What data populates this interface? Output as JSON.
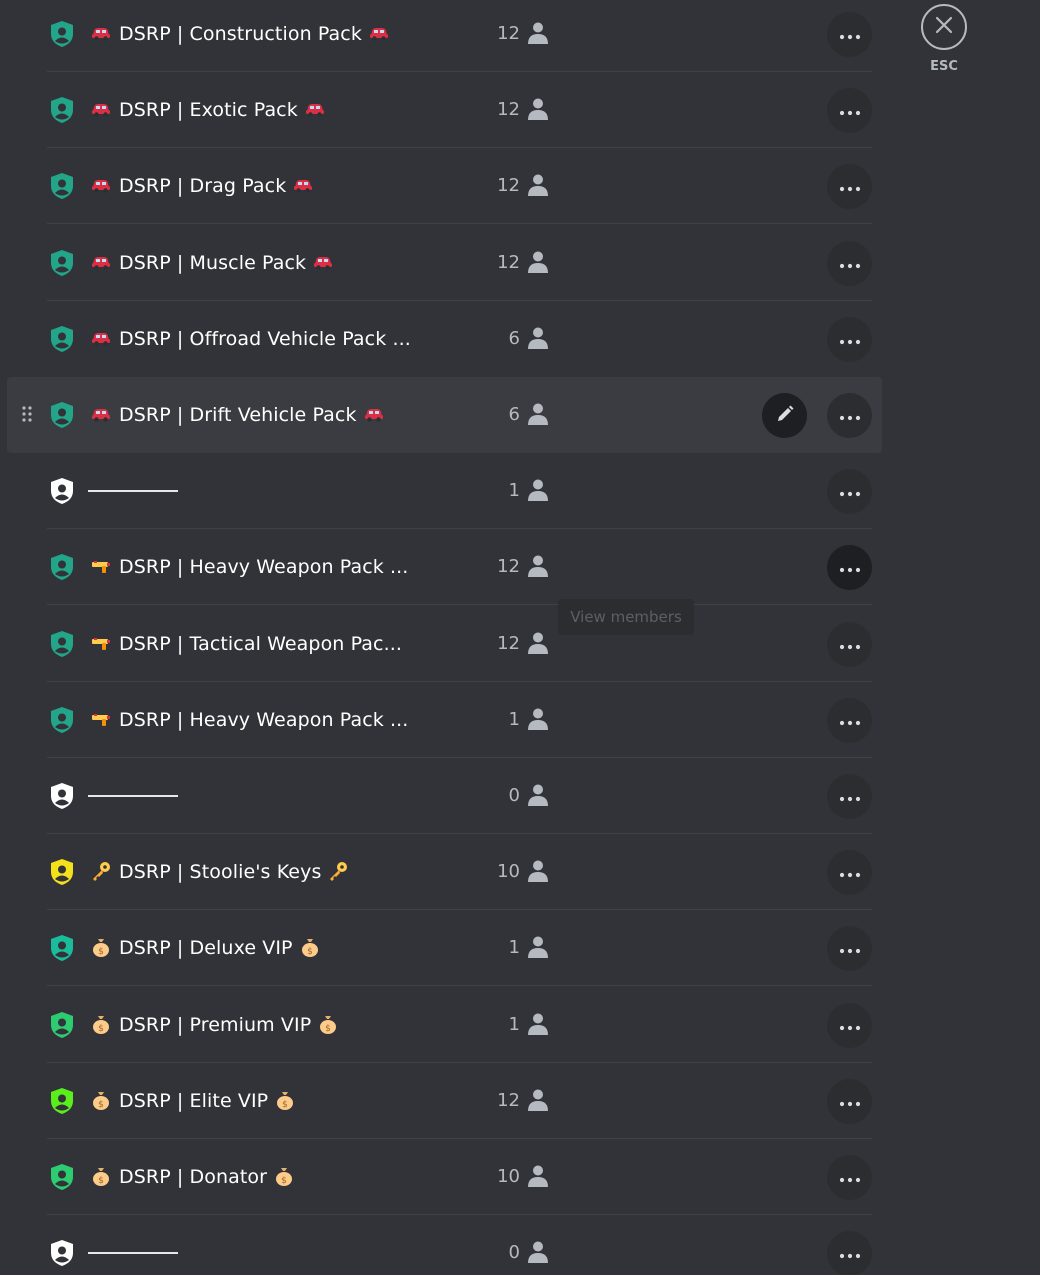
{
  "close": {
    "label": "ESC"
  },
  "tooltip": {
    "text": "View members"
  },
  "roles": [
    {
      "name": "DSRP | Construction Pack",
      "emoji": "car",
      "trail": "car",
      "count": "12",
      "shield_color": "#23a589",
      "divider": false
    },
    {
      "name": "DSRP | Exotic Pack",
      "emoji": "car",
      "trail": "car",
      "count": "12",
      "shield_color": "#23a589",
      "divider": false
    },
    {
      "name": "DSRP | Drag Pack",
      "emoji": "car",
      "trail": "car",
      "count": "12",
      "shield_color": "#23a589",
      "divider": false
    },
    {
      "name": "DSRP | Muscle Pack",
      "emoji": "car",
      "trail": "car",
      "count": "12",
      "shield_color": "#23a589",
      "divider": false
    },
    {
      "name": "DSRP | Offroad Vehicle Pack ...",
      "emoji": "car",
      "trail": "",
      "count": "6",
      "shield_color": "#23a589",
      "divider": false
    },
    {
      "name": "DSRP | Drift Vehicle Pack",
      "emoji": "car",
      "trail": "car",
      "count": "6",
      "shield_color": "#23a589",
      "divider": false,
      "active": true
    },
    {
      "name": "",
      "emoji": "",
      "trail": "",
      "count": "1",
      "shield_color": "#ffffff",
      "divider": true
    },
    {
      "name": "DSRP | Heavy Weapon Pack ...",
      "emoji": "gun",
      "trail": "",
      "count": "12",
      "shield_color": "#23a589",
      "divider": false,
      "hover_more": true
    },
    {
      "name": "DSRP | Tactical Weapon Pac...",
      "emoji": "gun",
      "trail": "",
      "count": "12",
      "shield_color": "#23a589",
      "divider": false
    },
    {
      "name": "DSRP | Heavy Weapon Pack ...",
      "emoji": "gun",
      "trail": "",
      "count": "1",
      "shield_color": "#23a589",
      "divider": false
    },
    {
      "name": "",
      "emoji": "",
      "trail": "",
      "count": "0",
      "shield_color": "#ffffff",
      "divider": true
    },
    {
      "name": "DSRP | Stoolie's Keys",
      "emoji": "key",
      "trail": "key",
      "count": "10",
      "shield_color": "#f5e11b",
      "divider": false
    },
    {
      "name": "DSRP | Deluxe VIP",
      "emoji": "moneybag",
      "trail": "moneybag",
      "count": "1",
      "shield_color": "#1abc9c",
      "divider": false
    },
    {
      "name": "DSRP | Premium VIP",
      "emoji": "moneybag",
      "trail": "moneybag",
      "count": "1",
      "shield_color": "#2ecc71",
      "divider": false
    },
    {
      "name": "DSRP | Elite VIP",
      "emoji": "moneybag",
      "trail": "moneybag",
      "count": "12",
      "shield_color": "#5aef1c",
      "divider": false
    },
    {
      "name": "DSRP | Donator",
      "emoji": "moneybag",
      "trail": "moneybag",
      "count": "10",
      "shield_color": "#2ecc71",
      "divider": false
    },
    {
      "name": "",
      "emoji": "",
      "trail": "",
      "count": "0",
      "shield_color": "#ffffff",
      "divider": true
    }
  ]
}
